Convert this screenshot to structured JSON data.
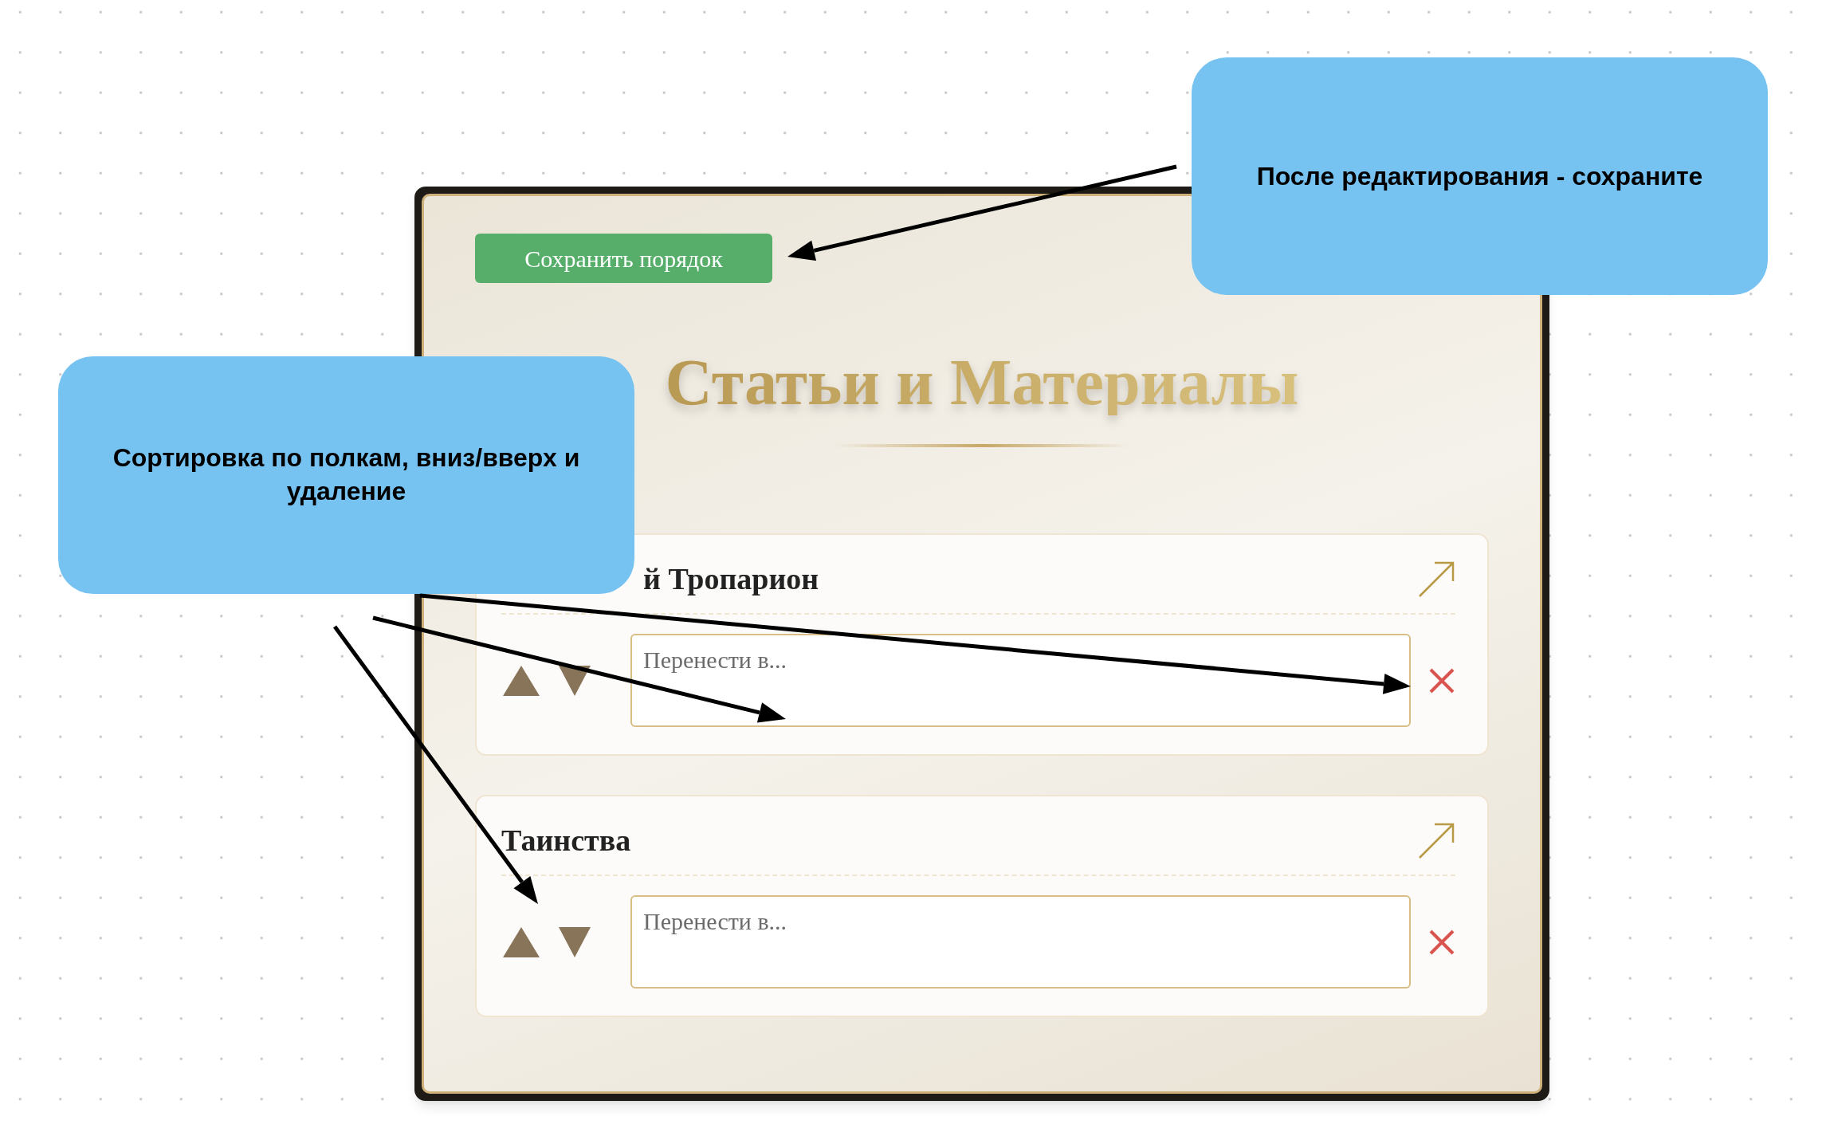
{
  "panel": {
    "save_button": "Сохранить порядок",
    "title": "Статьи и Материалы",
    "shelves": [
      {
        "title": "й Тропарион",
        "covered": true,
        "move_placeholder": "Перенести в..."
      },
      {
        "title": "Таинства",
        "covered": false,
        "move_placeholder": "Перенести в..."
      }
    ]
  },
  "notes": [
    {
      "text": "После редактирования - сохраните"
    },
    {
      "text": "Сортировка по полкам, вниз/вверх и удаление"
    }
  ]
}
